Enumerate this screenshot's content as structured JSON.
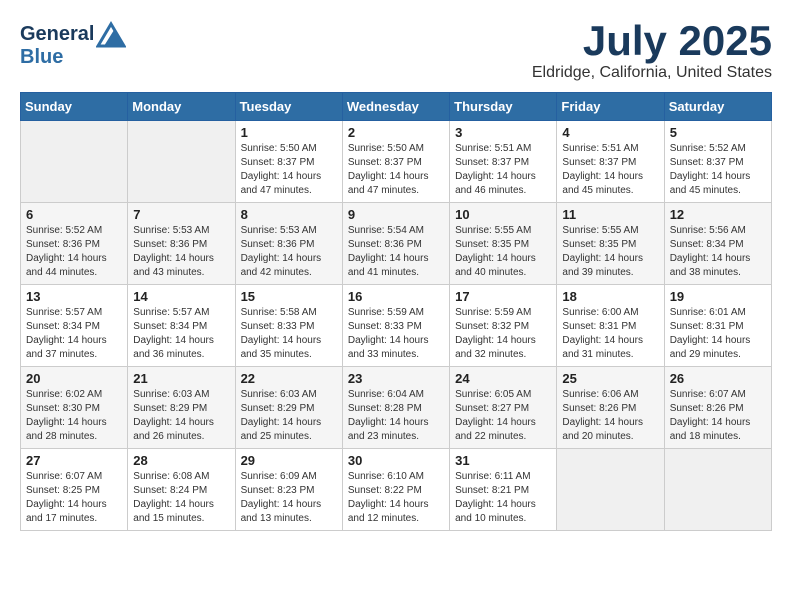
{
  "header": {
    "logo_line1": "General",
    "logo_line2": "Blue",
    "month": "July 2025",
    "location": "Eldridge, California, United States"
  },
  "weekdays": [
    "Sunday",
    "Monday",
    "Tuesday",
    "Wednesday",
    "Thursday",
    "Friday",
    "Saturday"
  ],
  "weeks": [
    [
      {
        "day": "",
        "detail": ""
      },
      {
        "day": "",
        "detail": ""
      },
      {
        "day": "1",
        "detail": "Sunrise: 5:50 AM\nSunset: 8:37 PM\nDaylight: 14 hours and 47 minutes."
      },
      {
        "day": "2",
        "detail": "Sunrise: 5:50 AM\nSunset: 8:37 PM\nDaylight: 14 hours and 47 minutes."
      },
      {
        "day": "3",
        "detail": "Sunrise: 5:51 AM\nSunset: 8:37 PM\nDaylight: 14 hours and 46 minutes."
      },
      {
        "day": "4",
        "detail": "Sunrise: 5:51 AM\nSunset: 8:37 PM\nDaylight: 14 hours and 45 minutes."
      },
      {
        "day": "5",
        "detail": "Sunrise: 5:52 AM\nSunset: 8:37 PM\nDaylight: 14 hours and 45 minutes."
      }
    ],
    [
      {
        "day": "6",
        "detail": "Sunrise: 5:52 AM\nSunset: 8:36 PM\nDaylight: 14 hours and 44 minutes."
      },
      {
        "day": "7",
        "detail": "Sunrise: 5:53 AM\nSunset: 8:36 PM\nDaylight: 14 hours and 43 minutes."
      },
      {
        "day": "8",
        "detail": "Sunrise: 5:53 AM\nSunset: 8:36 PM\nDaylight: 14 hours and 42 minutes."
      },
      {
        "day": "9",
        "detail": "Sunrise: 5:54 AM\nSunset: 8:36 PM\nDaylight: 14 hours and 41 minutes."
      },
      {
        "day": "10",
        "detail": "Sunrise: 5:55 AM\nSunset: 8:35 PM\nDaylight: 14 hours and 40 minutes."
      },
      {
        "day": "11",
        "detail": "Sunrise: 5:55 AM\nSunset: 8:35 PM\nDaylight: 14 hours and 39 minutes."
      },
      {
        "day": "12",
        "detail": "Sunrise: 5:56 AM\nSunset: 8:34 PM\nDaylight: 14 hours and 38 minutes."
      }
    ],
    [
      {
        "day": "13",
        "detail": "Sunrise: 5:57 AM\nSunset: 8:34 PM\nDaylight: 14 hours and 37 minutes."
      },
      {
        "day": "14",
        "detail": "Sunrise: 5:57 AM\nSunset: 8:34 PM\nDaylight: 14 hours and 36 minutes."
      },
      {
        "day": "15",
        "detail": "Sunrise: 5:58 AM\nSunset: 8:33 PM\nDaylight: 14 hours and 35 minutes."
      },
      {
        "day": "16",
        "detail": "Sunrise: 5:59 AM\nSunset: 8:33 PM\nDaylight: 14 hours and 33 minutes."
      },
      {
        "day": "17",
        "detail": "Sunrise: 5:59 AM\nSunset: 8:32 PM\nDaylight: 14 hours and 32 minutes."
      },
      {
        "day": "18",
        "detail": "Sunrise: 6:00 AM\nSunset: 8:31 PM\nDaylight: 14 hours and 31 minutes."
      },
      {
        "day": "19",
        "detail": "Sunrise: 6:01 AM\nSunset: 8:31 PM\nDaylight: 14 hours and 29 minutes."
      }
    ],
    [
      {
        "day": "20",
        "detail": "Sunrise: 6:02 AM\nSunset: 8:30 PM\nDaylight: 14 hours and 28 minutes."
      },
      {
        "day": "21",
        "detail": "Sunrise: 6:03 AM\nSunset: 8:29 PM\nDaylight: 14 hours and 26 minutes."
      },
      {
        "day": "22",
        "detail": "Sunrise: 6:03 AM\nSunset: 8:29 PM\nDaylight: 14 hours and 25 minutes."
      },
      {
        "day": "23",
        "detail": "Sunrise: 6:04 AM\nSunset: 8:28 PM\nDaylight: 14 hours and 23 minutes."
      },
      {
        "day": "24",
        "detail": "Sunrise: 6:05 AM\nSunset: 8:27 PM\nDaylight: 14 hours and 22 minutes."
      },
      {
        "day": "25",
        "detail": "Sunrise: 6:06 AM\nSunset: 8:26 PM\nDaylight: 14 hours and 20 minutes."
      },
      {
        "day": "26",
        "detail": "Sunrise: 6:07 AM\nSunset: 8:26 PM\nDaylight: 14 hours and 18 minutes."
      }
    ],
    [
      {
        "day": "27",
        "detail": "Sunrise: 6:07 AM\nSunset: 8:25 PM\nDaylight: 14 hours and 17 minutes."
      },
      {
        "day": "28",
        "detail": "Sunrise: 6:08 AM\nSunset: 8:24 PM\nDaylight: 14 hours and 15 minutes."
      },
      {
        "day": "29",
        "detail": "Sunrise: 6:09 AM\nSunset: 8:23 PM\nDaylight: 14 hours and 13 minutes."
      },
      {
        "day": "30",
        "detail": "Sunrise: 6:10 AM\nSunset: 8:22 PM\nDaylight: 14 hours and 12 minutes."
      },
      {
        "day": "31",
        "detail": "Sunrise: 6:11 AM\nSunset: 8:21 PM\nDaylight: 14 hours and 10 minutes."
      },
      {
        "day": "",
        "detail": ""
      },
      {
        "day": "",
        "detail": ""
      }
    ]
  ]
}
